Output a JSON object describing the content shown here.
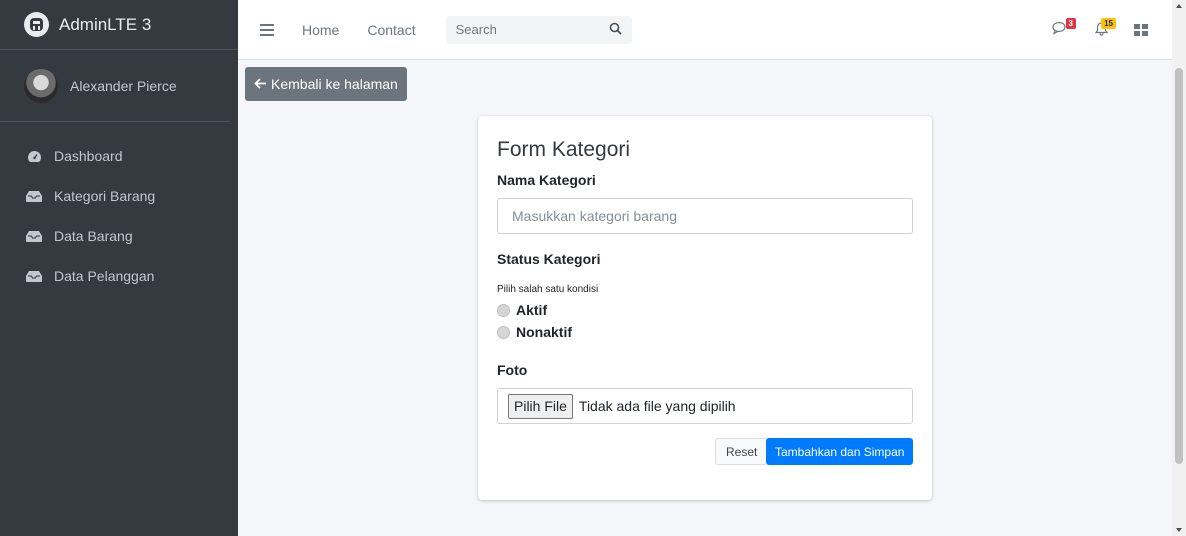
{
  "brand": {
    "name": "AdminLTE 3"
  },
  "user": {
    "name": "Alexander Pierce"
  },
  "sidebar": {
    "items": [
      {
        "label": "Dashboard",
        "icon": "tachometer-icon"
      },
      {
        "label": "Kategori Barang",
        "icon": "inbox-icon"
      },
      {
        "label": "Data Barang",
        "icon": "inbox-icon"
      },
      {
        "label": "Data Pelanggan",
        "icon": "inbox-icon"
      }
    ]
  },
  "navbar": {
    "home": "Home",
    "contact": "Contact",
    "search_placeholder": "Search",
    "messages_count": "3",
    "notifications_count": "15"
  },
  "content": {
    "back_label": "Kembali ke halaman"
  },
  "form": {
    "title": "Form Kategori",
    "name_label": "Nama Kategori",
    "name_placeholder": "Masukkan kategori barang",
    "status_label": "Status Kategori",
    "status_help": "Pilih salah satu kondisi",
    "option_active": "Aktif",
    "option_inactive": "Nonaktif",
    "photo_label": "Foto",
    "file_button": "Pilih File",
    "file_status": "Tidak ada file yang dipilih",
    "reset_label": "Reset",
    "submit_label": "Tambahkan dan Simpan"
  },
  "colors": {
    "sidebar_bg": "#343a40",
    "primary": "#007bff",
    "secondary": "#6c757d",
    "badge_danger": "#dc3545",
    "badge_warning": "#ffc107"
  }
}
